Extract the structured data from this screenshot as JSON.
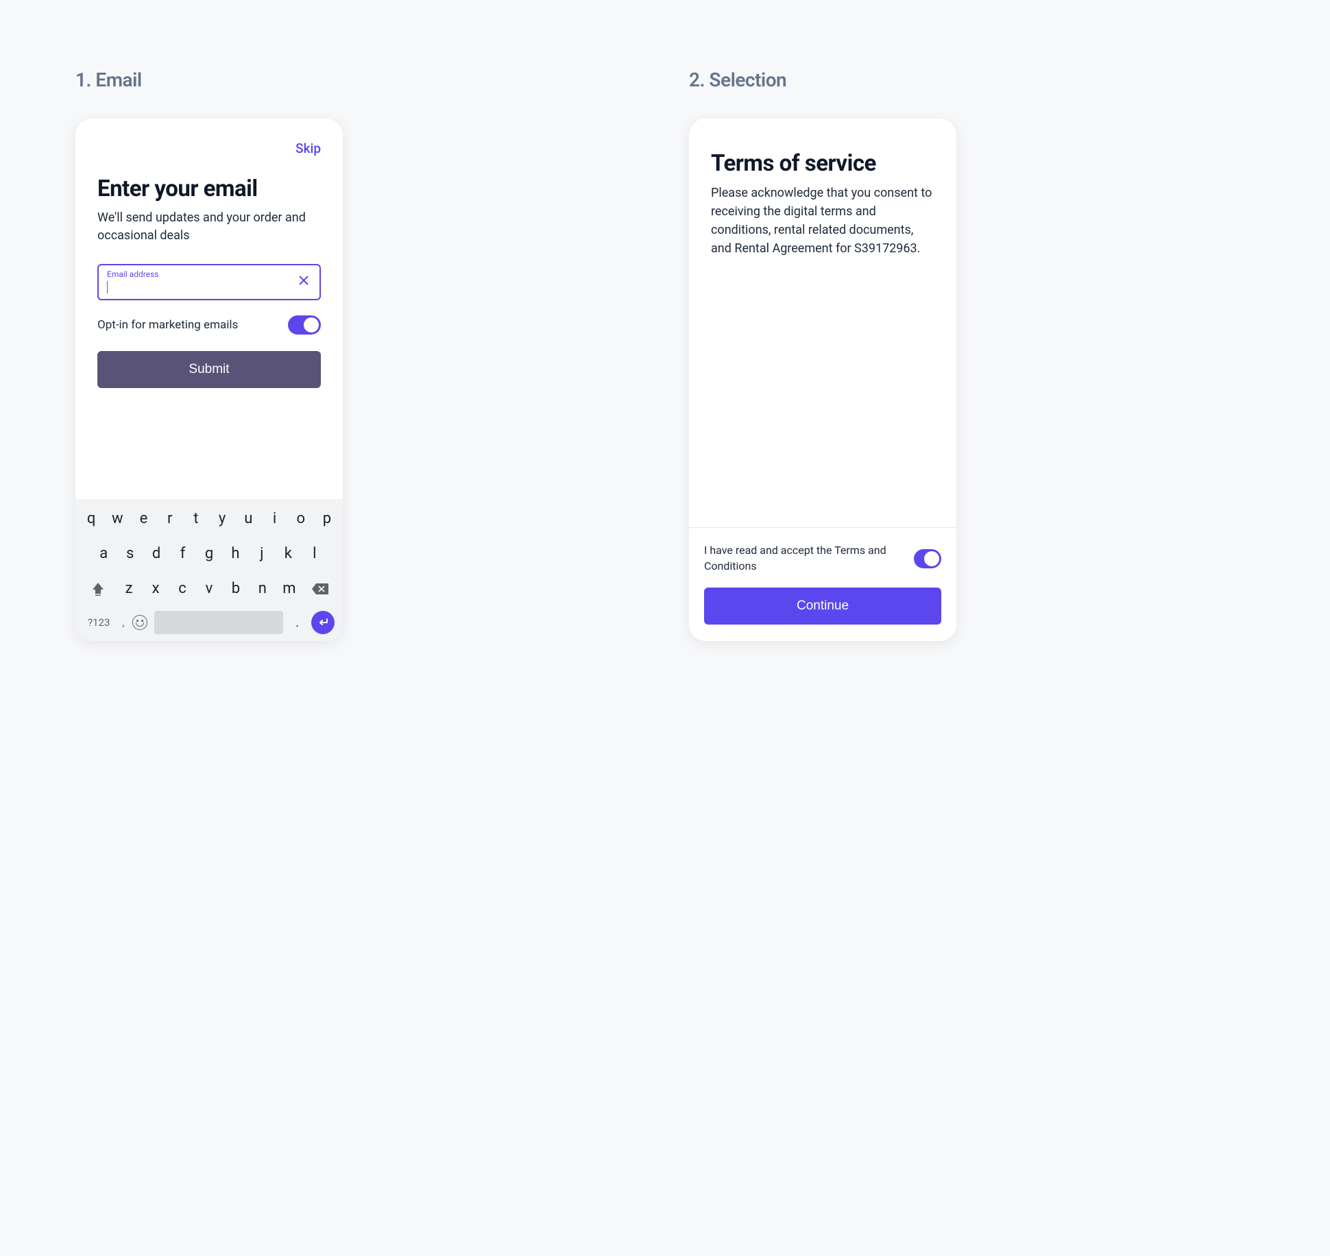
{
  "steps": {
    "email_heading": "1. Email",
    "selection_heading": "2. Selection"
  },
  "email_card": {
    "skip": "Skip",
    "title": "Enter your email",
    "subtitle": "We'll send updates and your order and occasional deals",
    "input_label": "Email address",
    "input_value": "",
    "optin_label": "Opt-in for marketing emails",
    "submit_label": "Submit"
  },
  "terms_card": {
    "title": "Terms of service",
    "description": "Please acknowledge that you consent to receiving the digital terms and conditions, rental related documents, and Rental Agreement for S39172963.",
    "accept_label": "I have read and accept the Terms and Conditions",
    "continue_label": "Continue"
  },
  "keyboard": {
    "row1": [
      "q",
      "w",
      "e",
      "r",
      "t",
      "y",
      "u",
      "i",
      "o",
      "p"
    ],
    "row2": [
      "a",
      "s",
      "d",
      "f",
      "g",
      "h",
      "j",
      "k",
      "l"
    ],
    "row3": [
      "z",
      "x",
      "c",
      "v",
      "b",
      "n",
      "m"
    ],
    "numeric_label": "?123",
    "comma": ",",
    "period": "."
  }
}
